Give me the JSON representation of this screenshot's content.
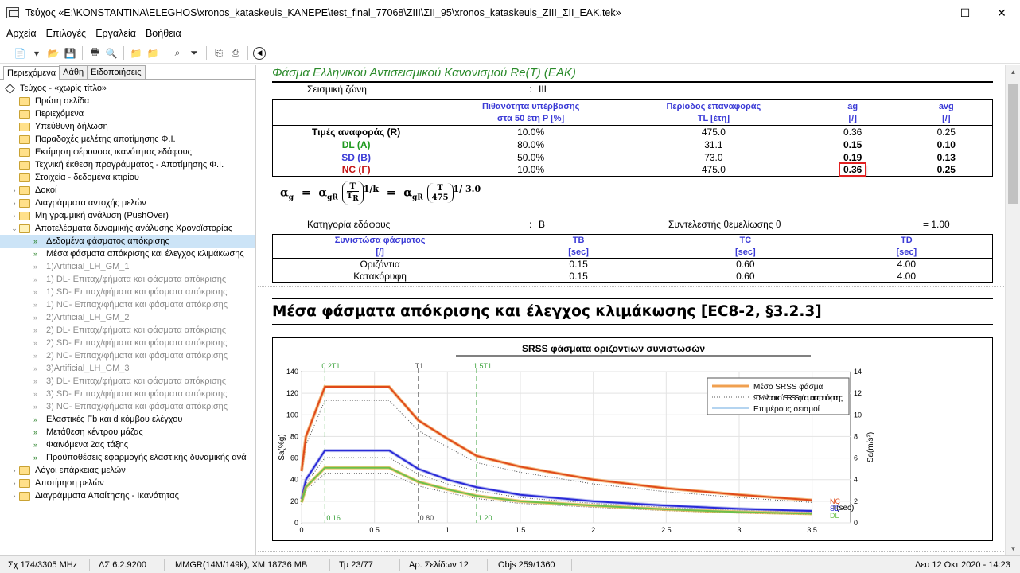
{
  "window": {
    "title": "Τεύχος «E:\\KONSTANTINA\\ELEGHOS\\xronos_kataskeuis_KANEPE\\test_final_77068\\ZIII\\ΣII_95\\xronos_kataskeuis_ZIII_ΣII_EAK.tek»",
    "minimize": "—",
    "maximize": "☐",
    "close": "✕"
  },
  "menu": [
    "Αρχεία",
    "Επιλογές",
    "Εργαλεία",
    "Βοήθεια"
  ],
  "tabs": [
    "Περιεχόμενα",
    "Λάθη",
    "Ειδοποιήσεις"
  ],
  "tree": [
    {
      "label": "Τεύχος - «χωρίς τίτλο»",
      "icon": "diamond-icon",
      "indent": 0,
      "exp": ""
    },
    {
      "label": "Πρώτη σελίδα",
      "icon": "folder-icon",
      "indent": 1,
      "exp": ""
    },
    {
      "label": "Περιεχόμενα",
      "icon": "folder-icon",
      "indent": 1,
      "exp": ""
    },
    {
      "label": "Υπεύθυνη δήλωση",
      "icon": "folder-icon",
      "indent": 1,
      "exp": ""
    },
    {
      "label": "Παραδοχές μελέτης αποτίμησης Φ.Ι.",
      "icon": "folder-icon",
      "indent": 1,
      "exp": ""
    },
    {
      "label": "Εκτίμηση φέρουσας ικανότητας εδάφους",
      "icon": "folder-icon",
      "indent": 1,
      "exp": ""
    },
    {
      "label": "Τεχνική έκθεση προγράμματος - Αποτίμησης Φ.Ι.",
      "icon": "folder-icon",
      "indent": 1,
      "exp": ""
    },
    {
      "label": "Στοιχεία - δεδομένα κτιρίου",
      "icon": "folder-icon",
      "indent": 1,
      "exp": ""
    },
    {
      "label": "Δοκοί",
      "icon": "folder-icon",
      "indent": 1,
      "exp": "›"
    },
    {
      "label": "Διαγράμματα αντοχής μελών",
      "icon": "folder-icon",
      "indent": 1,
      "exp": "›"
    },
    {
      "label": "Μη γραμμική ανάλυση (PushOver)",
      "icon": "folder-icon",
      "indent": 1,
      "exp": "›"
    },
    {
      "label": "Αποτελέσματα δυναμικής ανάλυσης Χρονοϊστορίας",
      "icon": "folder-open-icon",
      "indent": 1,
      "exp": "⌄"
    },
    {
      "label": "Δεδομένα φάσματος απόκρισης",
      "icon": "arrow-icon",
      "indent": 2,
      "exp": "",
      "selected": true
    },
    {
      "label": "Μέσα φάσματα απόκρισης και έλεγχος κλιμάκωσης",
      "icon": "arrow-icon",
      "indent": 2,
      "exp": ""
    },
    {
      "label": "1)Artificial_LH_GM_1",
      "icon": "arrow-grey-icon",
      "indent": 2,
      "exp": "",
      "grey": true
    },
    {
      "label": "1) DL- Επιταχ/φήματα και φάσματα απόκρισης",
      "icon": "arrow-grey-icon",
      "indent": 2,
      "exp": "",
      "grey": true
    },
    {
      "label": "1) SD- Επιταχ/φήματα και φάσματα απόκρισης",
      "icon": "arrow-grey-icon",
      "indent": 2,
      "exp": "",
      "grey": true
    },
    {
      "label": "1) NC- Επιταχ/φήματα και φάσματα απόκρισης",
      "icon": "arrow-grey-icon",
      "indent": 2,
      "exp": "",
      "grey": true
    },
    {
      "label": "2)Artificial_LH_GM_2",
      "icon": "arrow-grey-icon",
      "indent": 2,
      "exp": "",
      "grey": true
    },
    {
      "label": "2) DL- Επιταχ/φήματα και φάσματα απόκρισης",
      "icon": "arrow-grey-icon",
      "indent": 2,
      "exp": "",
      "grey": true
    },
    {
      "label": "2) SD- Επιταχ/φήματα και φάσματα απόκρισης",
      "icon": "arrow-grey-icon",
      "indent": 2,
      "exp": "",
      "grey": true
    },
    {
      "label": "2) NC- Επιταχ/φήματα και φάσματα απόκρισης",
      "icon": "arrow-grey-icon",
      "indent": 2,
      "exp": "",
      "grey": true
    },
    {
      "label": "3)Artificial_LH_GM_3",
      "icon": "arrow-grey-icon",
      "indent": 2,
      "exp": "",
      "grey": true
    },
    {
      "label": "3) DL- Επιταχ/φήματα και φάσματα απόκρισης",
      "icon": "arrow-grey-icon",
      "indent": 2,
      "exp": "",
      "grey": true
    },
    {
      "label": "3) SD- Επιταχ/φήματα και φάσματα απόκρισης",
      "icon": "arrow-grey-icon",
      "indent": 2,
      "exp": "",
      "grey": true
    },
    {
      "label": "3) NC- Επιταχ/φήματα και φάσματα απόκρισης",
      "icon": "arrow-grey-icon",
      "indent": 2,
      "exp": "",
      "grey": true
    },
    {
      "label": "Ελαστικές Fb και d κόμβου ελέγχου",
      "icon": "arrow-icon",
      "indent": 2,
      "exp": ""
    },
    {
      "label": "Μετάθεση κέντρου μάζας",
      "icon": "arrow-icon",
      "indent": 2,
      "exp": ""
    },
    {
      "label": "Φαινόμενα 2ας τάξης",
      "icon": "arrow-icon",
      "indent": 2,
      "exp": ""
    },
    {
      "label": "Προϋποθέσεις εφαρμογής ελαστικής δυναμικής ανά",
      "icon": "arrow-icon",
      "indent": 2,
      "exp": ""
    },
    {
      "label": "Λόγοι επάρκειας μελών",
      "icon": "folder-icon",
      "indent": 1,
      "exp": "›"
    },
    {
      "label": "Αποτίμηση μελών",
      "icon": "folder-icon",
      "indent": 1,
      "exp": "›"
    },
    {
      "label": "Διαγράμματα Απαίτησης - Ικανότητας",
      "icon": "folder-icon",
      "indent": 1,
      "exp": "›"
    }
  ],
  "doc": {
    "section_title": "Φάσμα Ελληνικού Αντισεισμικού Κανονισμού Re(T) (EAK)",
    "zone_label": "Σεισμική ζώνη",
    "zone_sep": ":",
    "zone_value": "III",
    "table1": {
      "h_prob_1": "Πιθανότητα υπέρβασης",
      "h_prob_2": "στα 50 έτη P [%]",
      "h_period_1": "Περίοδος επαναφοράς",
      "h_period_2": "TL [έτη]",
      "h_ag_1": "ag",
      "h_ag_2": "[/]",
      "h_avg_1": "avg",
      "h_avg_2": "[/]",
      "rows": [
        {
          "name": "Τιμές αναφοράς (R)",
          "p": "10.0%",
          "tl": "475.0",
          "ag": "0.36",
          "avg": "0.25"
        },
        {
          "name": "DL (A)",
          "p": "80.0%",
          "tl": "31.1",
          "ag": "0.15",
          "avg": "0.10"
        },
        {
          "name": "SD (B)",
          "p": "50.0%",
          "tl": "73.0",
          "ag": "0.19",
          "avg": "0.13"
        },
        {
          "name": "NC (Γ)",
          "p": "10.0%",
          "tl": "475.0",
          "ag": "0.36",
          "avg": "0.25"
        }
      ]
    },
    "formula": {
      "a": "α",
      "g": "g",
      "eq": "=",
      "agr": "α",
      "gr": "gR",
      "f1_num": "T",
      "f1_den": "T",
      "f1_den_sub": "R",
      "exp1": "1/k",
      "eq2": "=",
      "f2_num": "T",
      "f2_den": "475",
      "exp2": "1/ 3.0"
    },
    "soil_label": "Κατηγορία εδάφους",
    "soil_sep": ":",
    "soil_value": "B",
    "theta_label": "Συντελεστής θεμελίωσης θ",
    "theta_value": "=  1.00",
    "table2": {
      "h1_1": "Συνιστώσα φάσματος",
      "h1_2": "[/]",
      "h2_1": "TB",
      "h2_2": "[sec]",
      "h3_1": "TC",
      "h3_2": "[sec]",
      "h4_1": "TD",
      "h4_2": "[sec]",
      "rows": [
        {
          "name": "Οριζόντια",
          "tb": "0.15",
          "tc": "0.60",
          "td": "4.00"
        },
        {
          "name": "Κατακόρυφη",
          "tb": "0.15",
          "tc": "0.60",
          "td": "4.00"
        }
      ]
    },
    "h2": "Μέσα φάσματα απόκρισης και έλεγχος κλιμάκωσης [EC8-2, §3.2.3]"
  },
  "chart_data": {
    "type": "line",
    "title": "SRSS φάσματα οριζοντίων συνιστωσών",
    "ylabel": "Sa(%g)",
    "y2label": "Sa(m/s²)",
    "xlabel": "T(sec)",
    "xlim": [
      0,
      3.6
    ],
    "ylim": [
      0,
      140
    ],
    "y2lim": [
      0,
      14
    ],
    "xticks": [
      "0",
      "0.5",
      "1",
      "1.5",
      "2",
      "2.5",
      "3",
      "3.5"
    ],
    "yticks": [
      "0",
      "20",
      "40",
      "60",
      "80",
      "100",
      "120",
      "140"
    ],
    "y2ticks": [
      "0",
      "2",
      "4",
      "6",
      "8",
      "10",
      "12",
      "14"
    ],
    "vlines": [
      {
        "x": 0.16,
        "top": "0.2T1",
        "bottom": "0.16"
      },
      {
        "x": 0.8,
        "top": "T1",
        "bottom": "0.80"
      },
      {
        "x": 1.2,
        "top": "1.5T1",
        "bottom": "1.20"
      }
    ],
    "legend": {
      "position": "top-right",
      "items": [
        "Μέσο SRSS φάσμα",
        "90% ελαστικού SRSS φάσματος απόκρισης",
        "Επιμέρους σεισμοί"
      ]
    },
    "end_labels": [
      "NC",
      "SD",
      "DL"
    ],
    "series": [
      {
        "name": "NC",
        "color": "#e04a1a",
        "points": [
          [
            0,
            48
          ],
          [
            0.03,
            80
          ],
          [
            0.16,
            126
          ],
          [
            0.6,
            126
          ],
          [
            0.8,
            95
          ],
          [
            1.0,
            78
          ],
          [
            1.2,
            62
          ],
          [
            1.5,
            52
          ],
          [
            2.0,
            40
          ],
          [
            2.5,
            32
          ],
          [
            3.0,
            26
          ],
          [
            3.5,
            21
          ]
        ]
      },
      {
        "name": "SD",
        "color": "#2a2ad8",
        "points": [
          [
            0,
            22
          ],
          [
            0.03,
            40
          ],
          [
            0.16,
            67
          ],
          [
            0.6,
            67
          ],
          [
            0.8,
            50
          ],
          [
            1.0,
            40
          ],
          [
            1.2,
            33
          ],
          [
            1.5,
            26
          ],
          [
            2.0,
            20
          ],
          [
            2.5,
            16
          ],
          [
            3.0,
            13
          ],
          [
            3.5,
            11
          ]
        ]
      },
      {
        "name": "DL",
        "color": "#6cc04a",
        "points": [
          [
            0,
            19
          ],
          [
            0.03,
            33
          ],
          [
            0.16,
            51
          ],
          [
            0.6,
            51
          ],
          [
            0.8,
            38
          ],
          [
            1.0,
            31
          ],
          [
            1.2,
            25
          ],
          [
            1.5,
            20
          ],
          [
            2.0,
            16
          ],
          [
            2.5,
            12.5
          ],
          [
            3.0,
            10
          ],
          [
            3.5,
            8.5
          ]
        ]
      }
    ]
  },
  "status": {
    "s1": "Σχ 174/3305 MHz",
    "s2": "ΛΣ 6.2.9200",
    "s3": "MMGR(14M/149k), XM 18736 MB",
    "s4": "Τμ 23/77",
    "s5": "Αρ. Σελίδων 12",
    "s6": "Objs 259/1360",
    "s7": "Δευ 12 Οκτ 2020 - 14:23"
  }
}
